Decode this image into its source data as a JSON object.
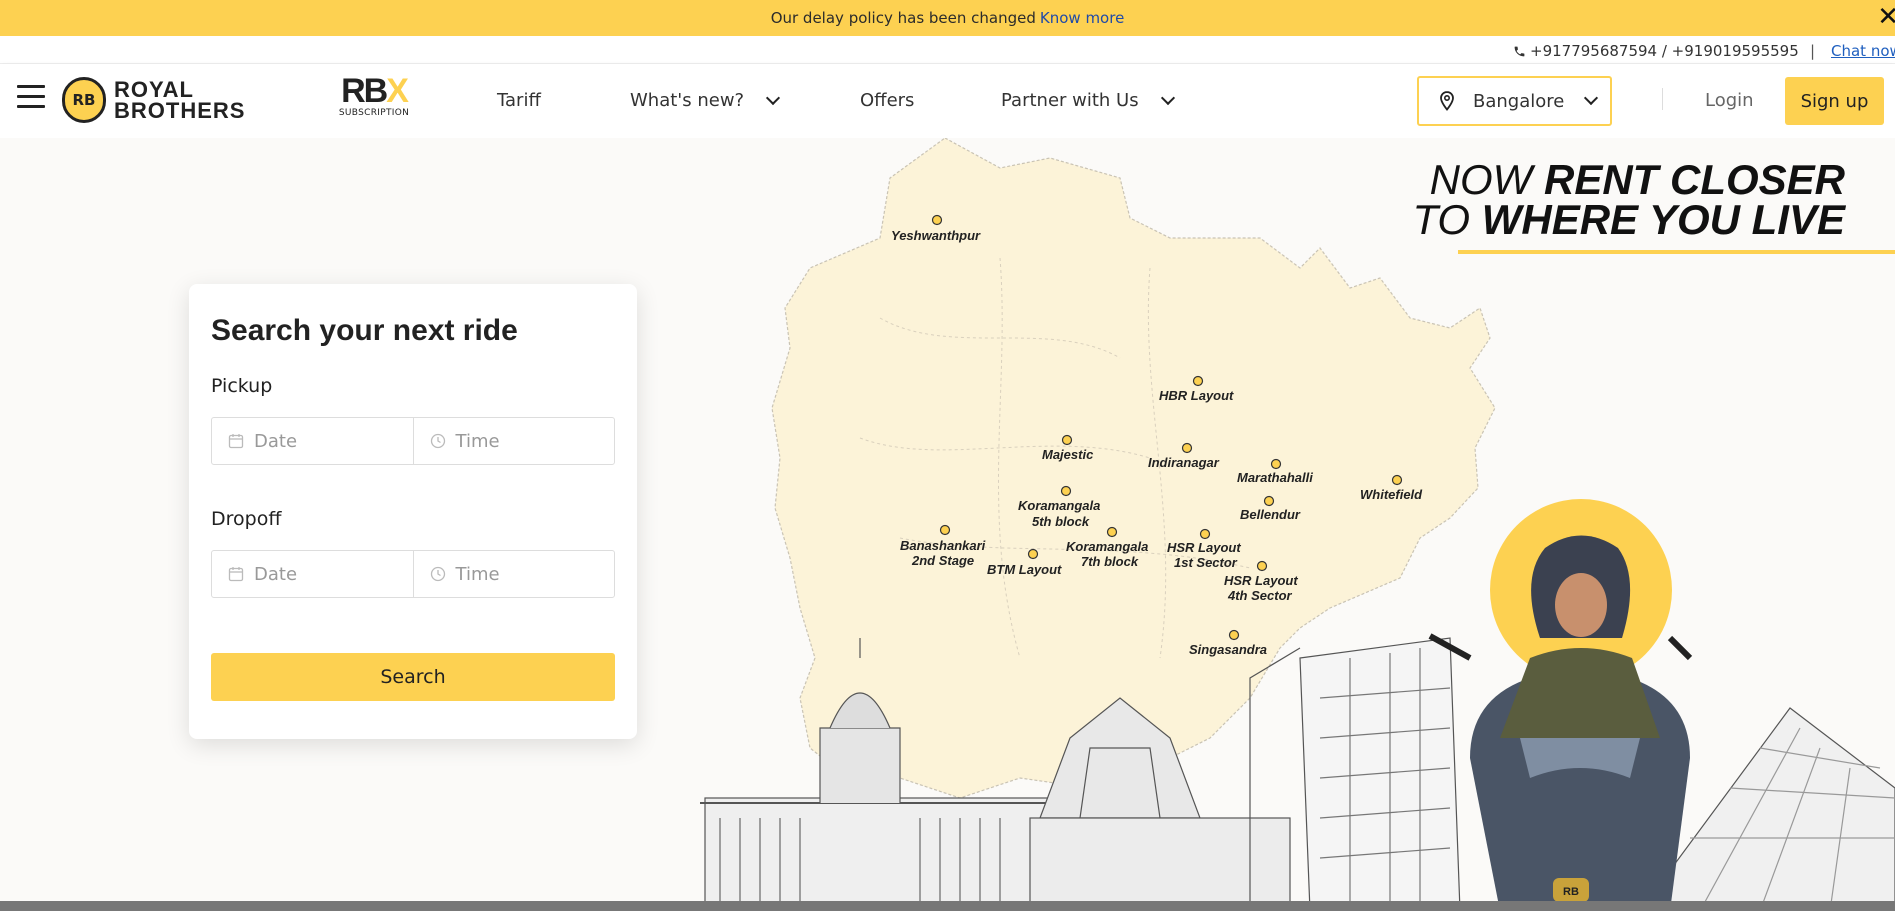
{
  "banner": {
    "text": "Our delay policy has been changed",
    "link": "Know more",
    "close": "✕"
  },
  "contact": {
    "phone": "+917795687594 / +919019595595",
    "separator": "|",
    "chat": "Chat now"
  },
  "brand": {
    "logo_badge": "RB",
    "logo_line1": "ROYAL",
    "logo_line2": "BROTHERS",
    "rbx": "RB",
    "rbx_x": "X",
    "rbx_sub": "SUBSCRIPTION"
  },
  "nav": {
    "tariff": "Tariff",
    "whats_new": "What's new?",
    "offers": "Offers",
    "partner": "Partner with Us",
    "city": "Bangalore",
    "login": "Login",
    "signup": "Sign up"
  },
  "search_card": {
    "title": "Search your next ride",
    "pickup_label": "Pickup",
    "dropoff_label": "Dropoff",
    "date_placeholder": "Date",
    "time_placeholder": "Time",
    "search_button": "Search"
  },
  "hero": {
    "tag_line1_a": "NOW ",
    "tag_line1_b": "RENT CLOSER",
    "tag_line2_a": "TO ",
    "tag_line2_b": "WHERE YOU LIVE",
    "scooter_badge": "RB"
  },
  "map_locations": [
    {
      "name": "Yeshwanthpur"
    },
    {
      "name": "HBR Layout"
    },
    {
      "name": "Majestic"
    },
    {
      "name": "Indiranagar"
    },
    {
      "name": "Marathahalli"
    },
    {
      "name": "Whitefield"
    },
    {
      "name": "Koramangala 5th block"
    },
    {
      "name": "Bellendur"
    },
    {
      "name": "Banashankari 2nd Stage"
    },
    {
      "name": "Koramangala 7th block"
    },
    {
      "name": "HSR Layout 1st Sector"
    },
    {
      "name": "BTM Layout"
    },
    {
      "name": "HSR Layout 4th Sector"
    },
    {
      "name": "Singasandra"
    }
  ],
  "icons": {
    "phone": "phone-icon",
    "pin": "location-pin-icon",
    "calendar": "calendar-icon",
    "clock": "clock-icon"
  },
  "colors": {
    "accent": "#fdd151",
    "link": "#1f4aa8",
    "background": "#fbfaf8"
  }
}
